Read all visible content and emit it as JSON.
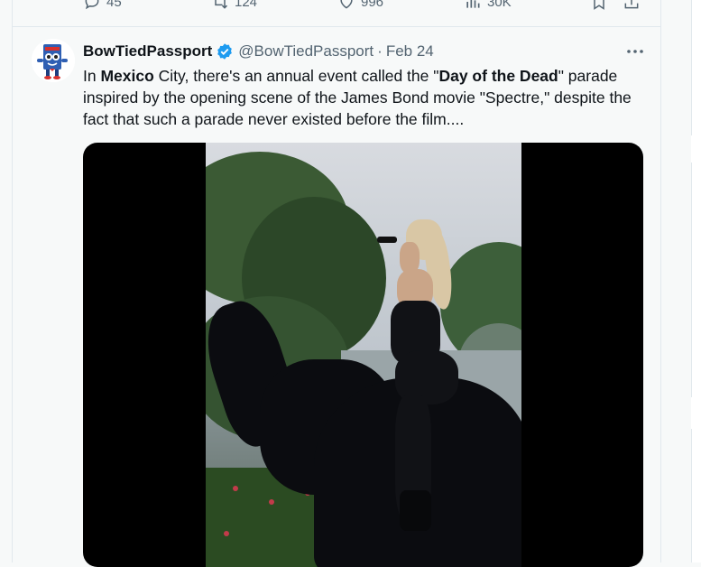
{
  "previous_tweet_actions": {
    "replies": "45",
    "reposts": "124",
    "likes": "996",
    "views": "30K"
  },
  "tweet": {
    "display_name": "BowTiedPassport",
    "handle": "@BowTiedPassport",
    "separator": "·",
    "date": "Feb 24",
    "text_parts": {
      "p1": "In ",
      "b1": "Mexico",
      "p2": " City, there's an annual event called the \"",
      "b2": "Day of the Dead",
      "p3": "\" parade inspired by the opening scene of the James Bond movie \"Spectre,\" despite the fact that such a parade never existed before the film...."
    },
    "verified_color": "#1d9bf0",
    "media_type": "video"
  },
  "icons": {
    "reply": "reply-icon",
    "repost": "repost-icon",
    "like": "heart-icon",
    "views": "views-chart-icon",
    "bookmark": "bookmark-icon",
    "share": "share-icon",
    "more": "more-icon",
    "verified": "verified-badge-icon"
  }
}
